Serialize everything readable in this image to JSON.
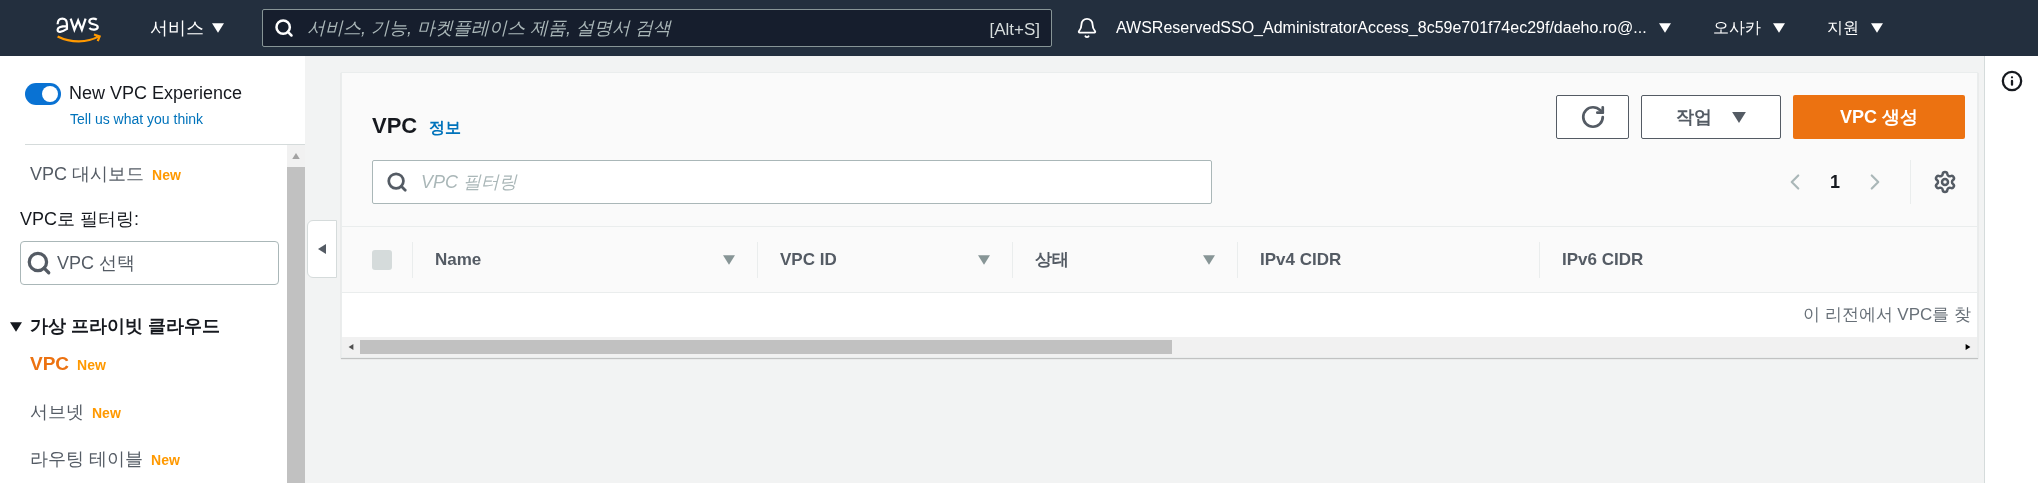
{
  "top_bar": {
    "services": "서비스",
    "search": {
      "placeholder": "서비스, 기능, 마켓플레이스 제품, 설명서 검색",
      "shortcut": "[Alt+S]"
    },
    "account": "AWSReservedSSO_AdministratorAccess_8c59e701f74ec29f/daeho.ro@...",
    "region": "오사카",
    "support": "지원"
  },
  "sidebar": {
    "experience_toggle": {
      "label": "New VPC Experience",
      "on": true
    },
    "feedback_link": "Tell us what you think",
    "items": [
      {
        "kind": "link",
        "label": "VPC 대시보드",
        "badge": "New",
        "selected": false
      },
      {
        "kind": "filter",
        "label": "VPC로 필터링:",
        "placeholder": "VPC 선택"
      },
      {
        "kind": "section",
        "label": "가상 프라이빗 클라우드",
        "expanded": true,
        "children": [
          {
            "kind": "link",
            "label": "VPC",
            "badge": "New",
            "selected": true
          },
          {
            "kind": "link",
            "label": "서브넷",
            "badge": "New",
            "selected": false
          },
          {
            "kind": "link",
            "label": "라우팅 테이블",
            "badge": "New",
            "selected": false
          }
        ]
      }
    ]
  },
  "panel": {
    "title": "VPC",
    "info_link": "정보",
    "actions_button": "작업",
    "create_button": "VPC 생성",
    "filter": {
      "placeholder": "VPC 필터링"
    },
    "page": "1",
    "table": {
      "columns": [
        {
          "label": "Name",
          "sortable": true
        },
        {
          "label": "VPC ID",
          "sortable": true
        },
        {
          "label": "상태",
          "sortable": true
        },
        {
          "label": "IPv4 CIDR",
          "sortable": false
        },
        {
          "label": "IPv6 CIDR",
          "sortable": false
        }
      ],
      "select_all": {
        "checked": false
      },
      "empty_message": "이 리전에서 VPC를 찾"
    }
  }
}
